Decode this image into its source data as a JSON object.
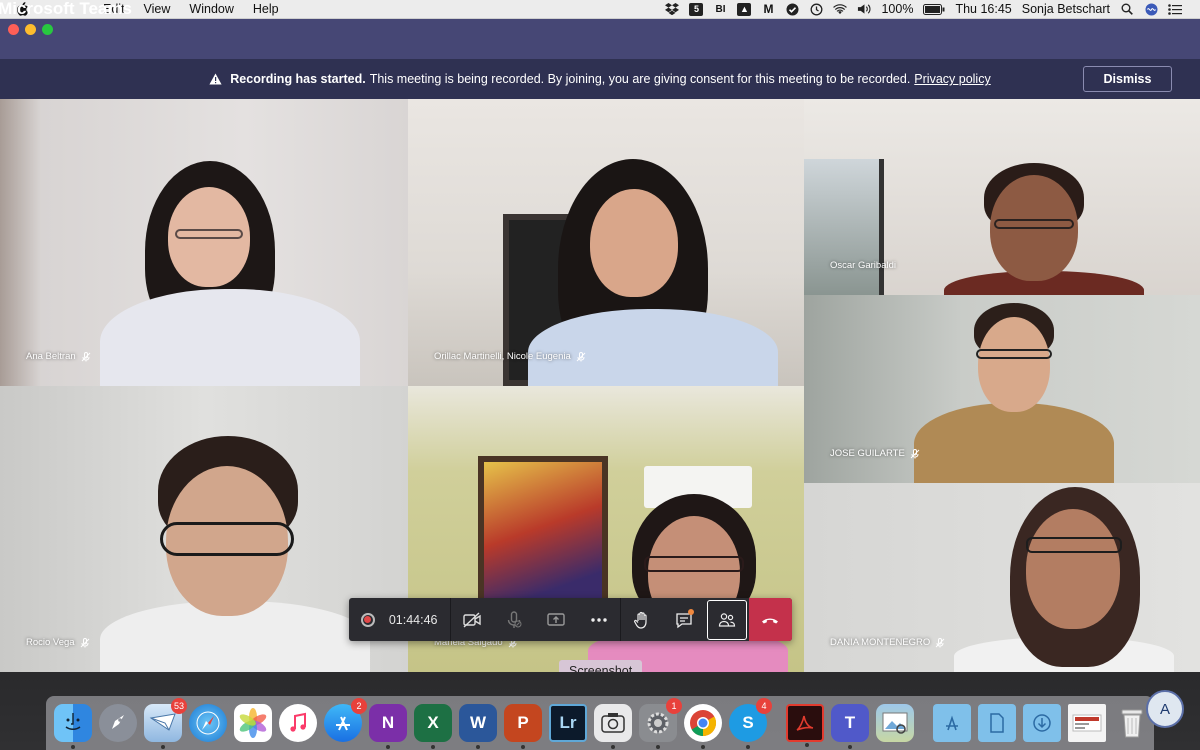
{
  "menubar": {
    "app_name": "Microsoft Teams",
    "items": [
      "Edit",
      "View",
      "Window",
      "Help"
    ],
    "battery": "100%",
    "clock": "Thu 16:45",
    "user": "Sonja Betschart"
  },
  "banner": {
    "title": "Recording has started.",
    "message": "This meeting is being recorded. By joining, you are giving consent for this meeting to be recorded.",
    "link": "Privacy policy",
    "dismiss": "Dismiss"
  },
  "participants": [
    {
      "name": "Ana Beltran"
    },
    {
      "name": "Orillac Martinelli, Nicole Eugenia"
    },
    {
      "name": "Oscar Garibaldi"
    },
    {
      "name": "JOSE GUILARTE"
    },
    {
      "name": "Rocio Vega"
    },
    {
      "name": "Mariela Salgado"
    },
    {
      "name": "DANIA MONTENEGRO"
    }
  ],
  "controls": {
    "timer": "01:44:46"
  },
  "tooltip": "Screenshot",
  "dock": {
    "mail_badge": "53",
    "appstore_badge": "2",
    "prefs_badge": "1",
    "skype_badge": "4",
    "word_letter": "W",
    "excel_letter": "X",
    "onenote_letter": "N",
    "ppt_letter": "P",
    "lr_label": "Lr",
    "teams_letter": "T",
    "skype_letter": "S",
    "avatar_letter": "A"
  }
}
